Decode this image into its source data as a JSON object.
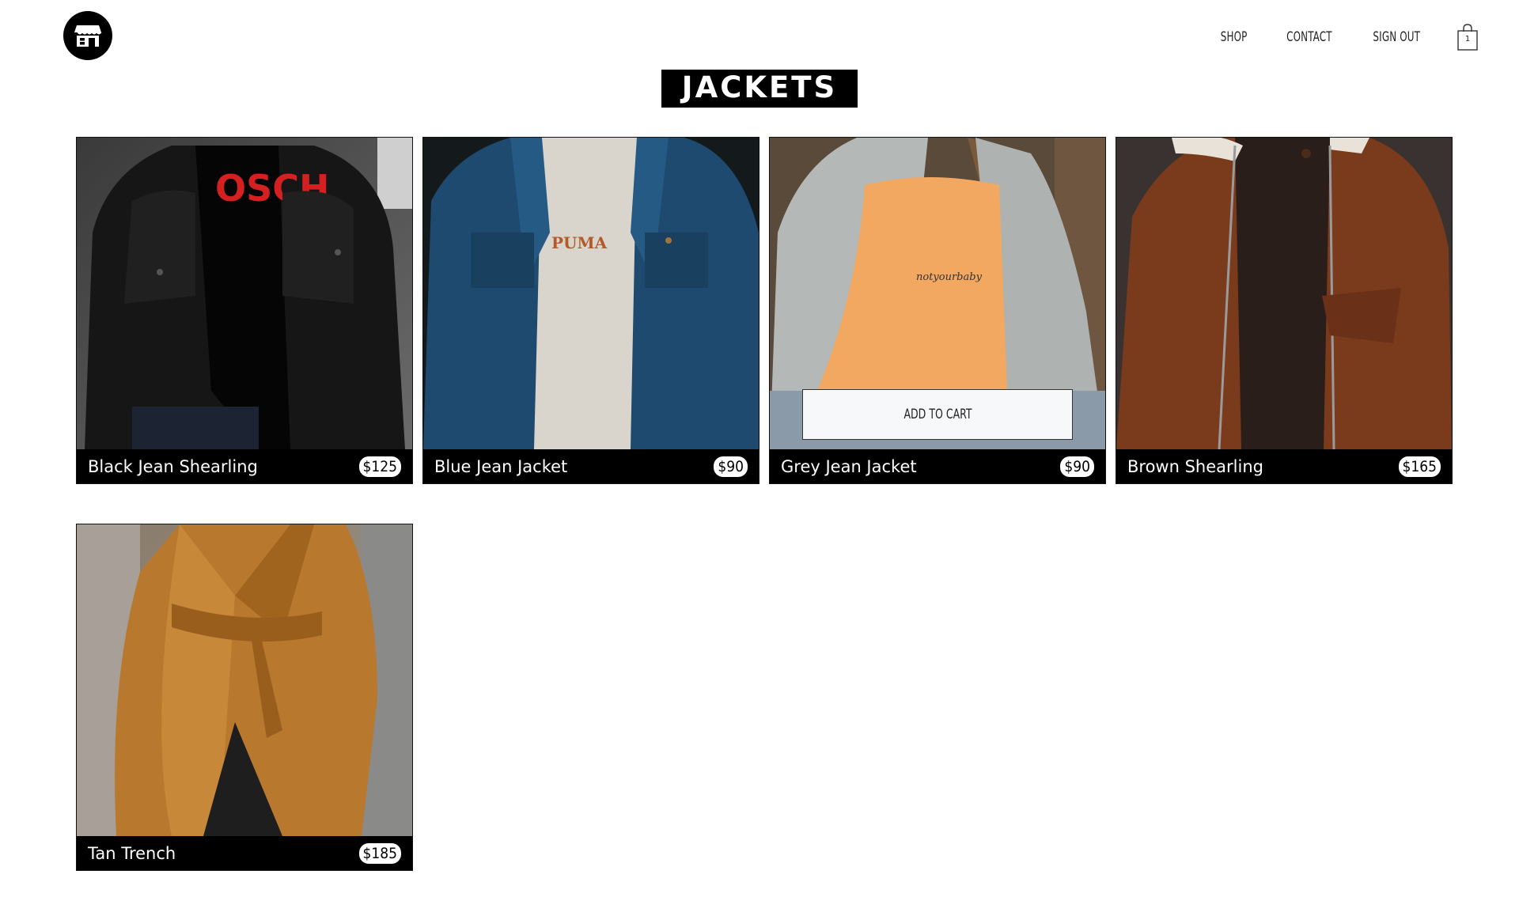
{
  "header": {
    "logo_icon": "storefront-icon",
    "nav": [
      {
        "label": "SHOP"
      },
      {
        "label": "CONTACT"
      },
      {
        "label": "SIGN OUT"
      }
    ],
    "cart": {
      "icon": "shopping-bag-icon",
      "count": "1"
    }
  },
  "page": {
    "title": "JACKETS"
  },
  "products": [
    {
      "name": "Black Jean Shearling",
      "price": "$125",
      "image": "black denim jacket over black tee"
    },
    {
      "name": "Blue Jean Jacket",
      "price": "$90",
      "image": "blue denim jacket over white tee"
    },
    {
      "name": "Grey Jean Jacket",
      "price": "$90",
      "image": "light grey denim jacket over orange tee",
      "hover_button": "ADD TO CART"
    },
    {
      "name": "Brown Shearling",
      "price": "$165",
      "image": "brown suede shearling jacket"
    },
    {
      "name": "Tan Trench",
      "price": "$185",
      "image": "tan belted trench coat"
    }
  ],
  "colors": {
    "background": "#ffffff",
    "accent": "#000000",
    "text_light": "#ffffff"
  }
}
